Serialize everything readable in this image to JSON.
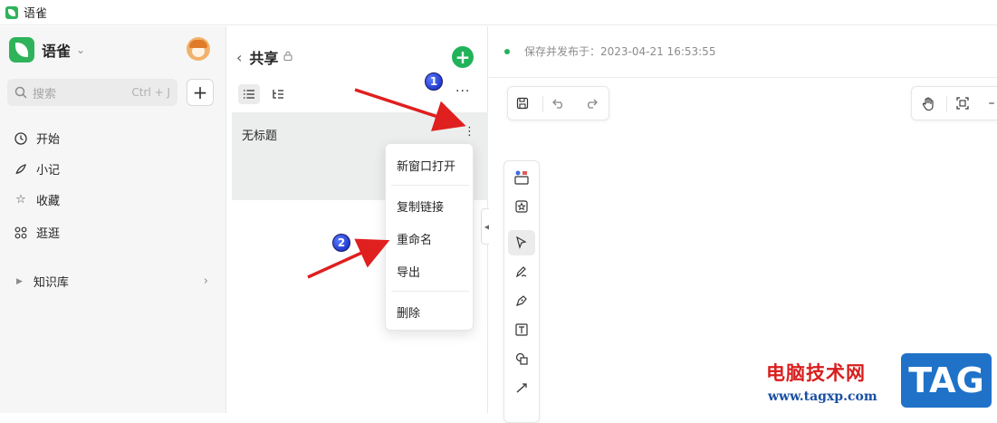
{
  "window": {
    "title": "语雀"
  },
  "sidebar": {
    "brand": "语雀",
    "search": {
      "placeholder": "搜索",
      "shortcut": "Ctrl + J"
    },
    "nav": [
      {
        "label": "开始",
        "icon": "clock-icon"
      },
      {
        "label": "小记",
        "icon": "feather-icon"
      },
      {
        "label": "收藏",
        "icon": "star-icon"
      },
      {
        "label": "逛逛",
        "icon": "grid-icon"
      }
    ],
    "knowledge_base": {
      "label": "知识库"
    }
  },
  "doc_panel": {
    "title": "共享",
    "documents": [
      {
        "name": "无标题"
      }
    ]
  },
  "context_menu": {
    "items": [
      "新窗口打开",
      "复制链接",
      "重命名",
      "导出",
      "删除"
    ]
  },
  "editor": {
    "status_text": "保存并发布于：2023-04-21 16:53:55"
  },
  "annotations": {
    "badge1": "1",
    "badge2": "2"
  },
  "watermark": {
    "text": "电脑技术网",
    "url": "www.tagxp.com",
    "tag": "TAG"
  },
  "colors": {
    "accent_green": "#22b35a",
    "arrow_red": "#e01f1f",
    "badge_blue": "#0b1fb8"
  }
}
